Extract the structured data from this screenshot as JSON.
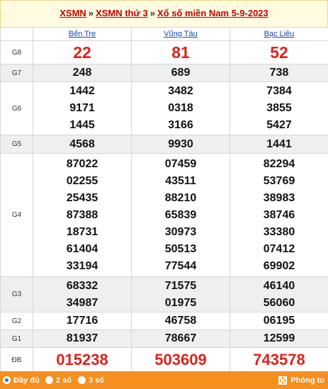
{
  "breadcrumb": {
    "link1": "XSMN",
    "sep1": "»",
    "link2": "XSMN thứ 3",
    "sep2": "»",
    "link3": "Xổ số miền Nam 5-9-2023"
  },
  "provinces": [
    "Bến Tre",
    "Vũng Tàu",
    "Bạc Liêu"
  ],
  "prizes": {
    "g8": {
      "label": "G8",
      "values": [
        [
          "22"
        ],
        [
          "81"
        ],
        [
          "52"
        ]
      ]
    },
    "g7": {
      "label": "G7",
      "values": [
        [
          "248"
        ],
        [
          "689"
        ],
        [
          "738"
        ]
      ]
    },
    "g6": {
      "label": "G6",
      "values": [
        [
          "1442",
          "9171",
          "1445"
        ],
        [
          "3482",
          "0318",
          "3166"
        ],
        [
          "7384",
          "3855",
          "5427"
        ]
      ]
    },
    "g5": {
      "label": "G5",
      "values": [
        [
          "4568"
        ],
        [
          "9930"
        ],
        [
          "1441"
        ]
      ]
    },
    "g4": {
      "label": "G4",
      "values": [
        [
          "87022",
          "02255",
          "25435",
          "87388",
          "18731",
          "61404",
          "33194"
        ],
        [
          "07459",
          "43511",
          "88210",
          "65839",
          "30973",
          "50513",
          "77544"
        ],
        [
          "82294",
          "53769",
          "38983",
          "38746",
          "33380",
          "07412",
          "69902"
        ]
      ]
    },
    "g3": {
      "label": "G3",
      "values": [
        [
          "68332",
          "34987"
        ],
        [
          "71575",
          "01975"
        ],
        [
          "46140",
          "56060"
        ]
      ]
    },
    "g2": {
      "label": "G2",
      "values": [
        [
          "17716"
        ],
        [
          "46758"
        ],
        [
          "06195"
        ]
      ]
    },
    "g1": {
      "label": "G1",
      "values": [
        [
          "81937"
        ],
        [
          "78667"
        ],
        [
          "12599"
        ]
      ]
    },
    "db": {
      "label": "ĐB",
      "values": [
        [
          "015238"
        ],
        [
          "503609"
        ],
        [
          "743578"
        ]
      ]
    }
  },
  "footer": {
    "options": [
      {
        "label": "Đầy đủ",
        "selected": true
      },
      {
        "label": "2 số",
        "selected": false
      },
      {
        "label": "3 số",
        "selected": false
      }
    ],
    "zoom_label": "Phóng to"
  },
  "colors": {
    "accent_red": "#e2201a",
    "link_blue": "#1a46b3",
    "footer_orange": "#f58f1f",
    "header_bg": "#fffbe1"
  }
}
